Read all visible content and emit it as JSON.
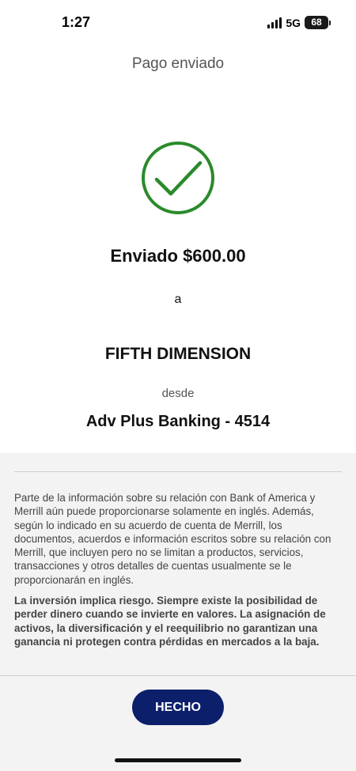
{
  "status_bar": {
    "time": "1:27",
    "network": "5G",
    "battery": "68",
    "signal_icon": "signal-bars-icon",
    "battery_icon": "battery-icon"
  },
  "header": {
    "title": "Pago enviado"
  },
  "confirmation": {
    "icon": "checkmark-circle-icon",
    "accent_color": "#2a8a2a",
    "amount_line": "Enviado $600.00",
    "to_word": "a",
    "recipient": "FIFTH DIMENSION",
    "from_word": "desde",
    "account": "Adv Plus Banking - 4514"
  },
  "disclosure": {
    "paragraph1": "Parte de la información sobre su relación con Bank of America y Merrill aún puede proporcionarse solamente en inglés. Además, según lo indicado en su acuerdo de cuenta de Merrill, los documentos, acuerdos e información escritos sobre su relación con Merrill, que incluyen pero no se limitan a productos, servicios, transacciones y otros detalles de cuentas usualmente se le proporcionarán en inglés.",
    "paragraph2": "La inversión implica riesgo. Siempre existe la posibilidad de perder dinero cuando se invierte en valores. La asignación de activos, la diversificación y el reequilibrio no garantizan una ganancia ni protegen contra pérdidas en mercados a la baja."
  },
  "actions": {
    "done_label": "HECHO",
    "done_color": "#0b1f6b"
  }
}
